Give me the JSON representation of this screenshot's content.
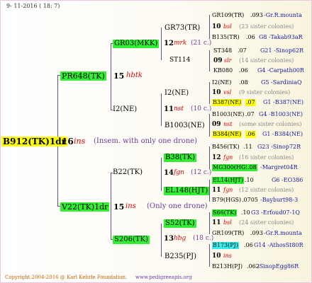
{
  "date": "9- 11-2016 ( 18: 7)",
  "copyright": "Copyright 2004-2016 @ Karl Kehrle Foundation.",
  "url": "www.pedigreeapis.org",
  "root": {
    "name": "B912(TK)1dr",
    "count": "16",
    "tag": "ins",
    "note": "(Insem. with only one drone)"
  },
  "gen1": [
    {
      "name": "PR648(TK)",
      "count": "15",
      "tag": "hbtk"
    },
    {
      "name": "V22(TK)1dr",
      "count": "15",
      "tag": "ins",
      "note": "(Only one drone)"
    }
  ],
  "gen2": [
    {
      "name": "GR03(MKK)",
      "count": "12",
      "tag": "mrk",
      "note": "(21 c.)"
    },
    {
      "name": "I2(NE)",
      "count": "11",
      "tag": "nst",
      "note": "(10 c.)"
    },
    {
      "name": "B22(TK)",
      "count": "14",
      "tag": "fgn",
      "note": "(12 c.)"
    },
    {
      "name": "S206(TK)",
      "count": "13",
      "tag": "hbg",
      "note": "(18 c.)"
    }
  ],
  "gen3": [
    {
      "name": "GR73(TR)"
    },
    {
      "name": "ST114"
    },
    {
      "name": "I2(NE)"
    },
    {
      "name": "B1003(NE)"
    },
    {
      "name": "B38(TK)"
    },
    {
      "name": "EL148(HJT)"
    },
    {
      "name": "S52(TK)"
    },
    {
      "name": "B235(PJ)"
    }
  ],
  "gen4": [
    {
      "a": "GR109(TR)",
      "b": ".093",
      "c": "-Gr.R.mounta"
    },
    {
      "count": "10",
      "tag": "bsl",
      "note": "(23 sister colonies)"
    },
    {
      "a": "B135(TR)",
      "b": ".06",
      "c": "G8 -Takab93aR"
    },
    {
      "a": "ST348",
      "b": ".07",
      "c": "G21 -Sinop62R"
    },
    {
      "count": "09",
      "tag": "slr",
      "note": "(14 sister colonies)"
    },
    {
      "a": "KB080",
      "b": ".06",
      "c": "G4 -Carpath00R"
    },
    {
      "a": "I2(NE)",
      "b": ".08",
      "c": "G5 -SardiniaQ"
    },
    {
      "count": "10",
      "tag": "vsl",
      "note": "(9 sister colonies)"
    },
    {
      "a": "B387(NE)",
      "b": ".07",
      "c": "G1 -B387(NE)"
    },
    {
      "a": "B1003(NE)",
      "b": ".07",
      "c": "G4 -B1003(NE)"
    },
    {
      "count": "09",
      "tag": "nst",
      "note": "(some sister colonies)"
    },
    {
      "a": "B384(NE)",
      "b": ".06",
      "c": "G1 -B384(NE)"
    },
    {
      "a": "B456(TK)",
      "b": ".11",
      "c": "G23 -Sinop72R"
    },
    {
      "count": "12",
      "tag": "fgn",
      "note": "(16 sister colonies)"
    },
    {
      "a": "MG300(HGS)",
      "b": ".08",
      "c": "-Margret04R"
    },
    {
      "a": "EL14(HJT)",
      "b": ".10",
      "c": "G6 -EO386"
    },
    {
      "count": "11",
      "tag": "fgn",
      "note": "(12 sister colonies)"
    },
    {
      "a": "B79(HGS)",
      "b": ".0705",
      "c": "-Bayburt98-3"
    },
    {
      "a": "S66(TK)",
      "b": ".10",
      "c": "G3 -Erfoud07-1Q"
    },
    {
      "count": "11",
      "tag": "bsl",
      "note": "(24 sister colonies)"
    },
    {
      "a": "GR109(TR)",
      "b": ".093",
      "c": "-Gr.R.mounta"
    },
    {
      "a": "B173(PJ)",
      "b": ".06",
      "c": "G14 -AthosSt80R"
    },
    {
      "count": "10",
      "tag": "ins",
      "note": ""
    },
    {
      "a": "B213H(PJ)",
      "b": ".062",
      "c": "-SinopEgg86R"
    }
  ]
}
